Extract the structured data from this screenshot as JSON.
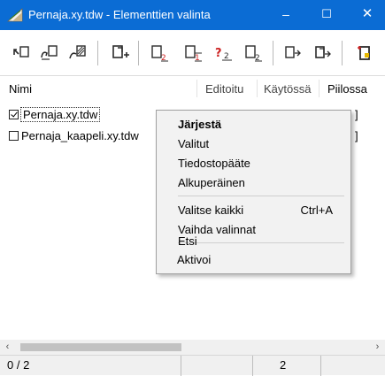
{
  "window": {
    "title": "Pernaja.xy.tdw - Elementtien valinta",
    "minimize": "–",
    "maximize": "☐",
    "close": "✕",
    "app_icon": "ruler-triangle-icon"
  },
  "toolbar": {
    "icons": [
      "arrow-select-icon",
      "select-shape-icon",
      "select-hatch-icon",
      "add-element-icon",
      "element-type-1-icon",
      "element-type-2-icon",
      "element-query-icon",
      "element-type-3-icon",
      "move-element-icon",
      "move-element-2-icon",
      "new-document-icon"
    ]
  },
  "list": {
    "columns": [
      "Nimi",
      "Editoitu",
      "Käytössä",
      "Piilossa"
    ],
    "rows": [
      {
        "name": "Pernaja.xy.tdw",
        "checked": true,
        "bracket": "]"
      },
      {
        "name": "Pernaja_kaapeli.xy.tdw",
        "checked": false,
        "bracket": "]"
      }
    ]
  },
  "scrollbar": {
    "left_arrow": "‹",
    "right_arrow": "›"
  },
  "status": {
    "count": "0 / 2",
    "value": "2"
  },
  "context_menu": {
    "header": "Järjestä",
    "sort_items": [
      "Valitut",
      "Tiedostopääte",
      "Alkuperäinen"
    ],
    "select_all": "Valitse kaikki",
    "select_all_shortcut": "Ctrl+A",
    "invert": "Vaihda valinnat",
    "search": "Etsi",
    "activate": "Aktivoi"
  },
  "colors": {
    "titlebar": "#0b6cd4",
    "menu_bg": "#f2f2f2",
    "icon_dark": "#2b2b2b",
    "icon_red": "#cc2222",
    "icon_yellow": "#e6b800"
  }
}
